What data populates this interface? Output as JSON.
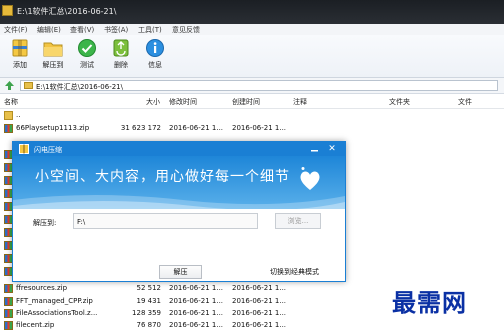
{
  "window": {
    "title": "E:\\1软件汇总\\2016-06-21\\"
  },
  "menu": [
    "文件(F)",
    "编辑(E)",
    "查看(V)",
    "书签(A)",
    "工具(T)",
    "意见反馈"
  ],
  "toolbar": {
    "add": "添加",
    "extract": "解压到",
    "test": "测试",
    "delete": "删除",
    "info": "信息"
  },
  "address": {
    "path": "E:\\1软件汇总\\2016-06-21\\"
  },
  "columns": {
    "name": "名称",
    "size": "大小",
    "modified": "修改时间",
    "created": "创建时间",
    "comment": "注释",
    "folders": "文件夹",
    "files": "文件"
  },
  "rows": [
    {
      "name": "..",
      "size": "",
      "modified": "",
      "created": ""
    },
    {
      "name": "66Playsetup1113.zip",
      "size": "31 623 172",
      "modified": "2016-06-21 1...",
      "created": "2016-06-21 1..."
    },
    {
      "name": "ffresources.zip",
      "size": "52 512",
      "modified": "2016-06-21 1...",
      "created": "2016-06-21 1..."
    },
    {
      "name": "FFT_managed_CPP.zip",
      "size": "19 431",
      "modified": "2016-06-21 1...",
      "created": "2016-06-21 1..."
    },
    {
      "name": "FileAssociationsTool.z...",
      "size": "128 359",
      "modified": "2016-06-21 1...",
      "created": "2016-06-21 1..."
    },
    {
      "name": "filecent.zip",
      "size": "76 870",
      "modified": "2016-06-21 1...",
      "created": "2016-06-21 1..."
    }
  ],
  "dialog": {
    "title": "闪电压缩",
    "slogan": "小空间、大内容，用心做好每一个细节",
    "extract_label": "解压到:",
    "extract_path": "F:\\",
    "browse": "浏览...",
    "extract_button": "解压",
    "switch_mode": "切换到经典模式"
  },
  "watermark": "最需网",
  "colors": {
    "dialog_blue": "#1a7fd4",
    "watermark": "#0a30a4"
  }
}
